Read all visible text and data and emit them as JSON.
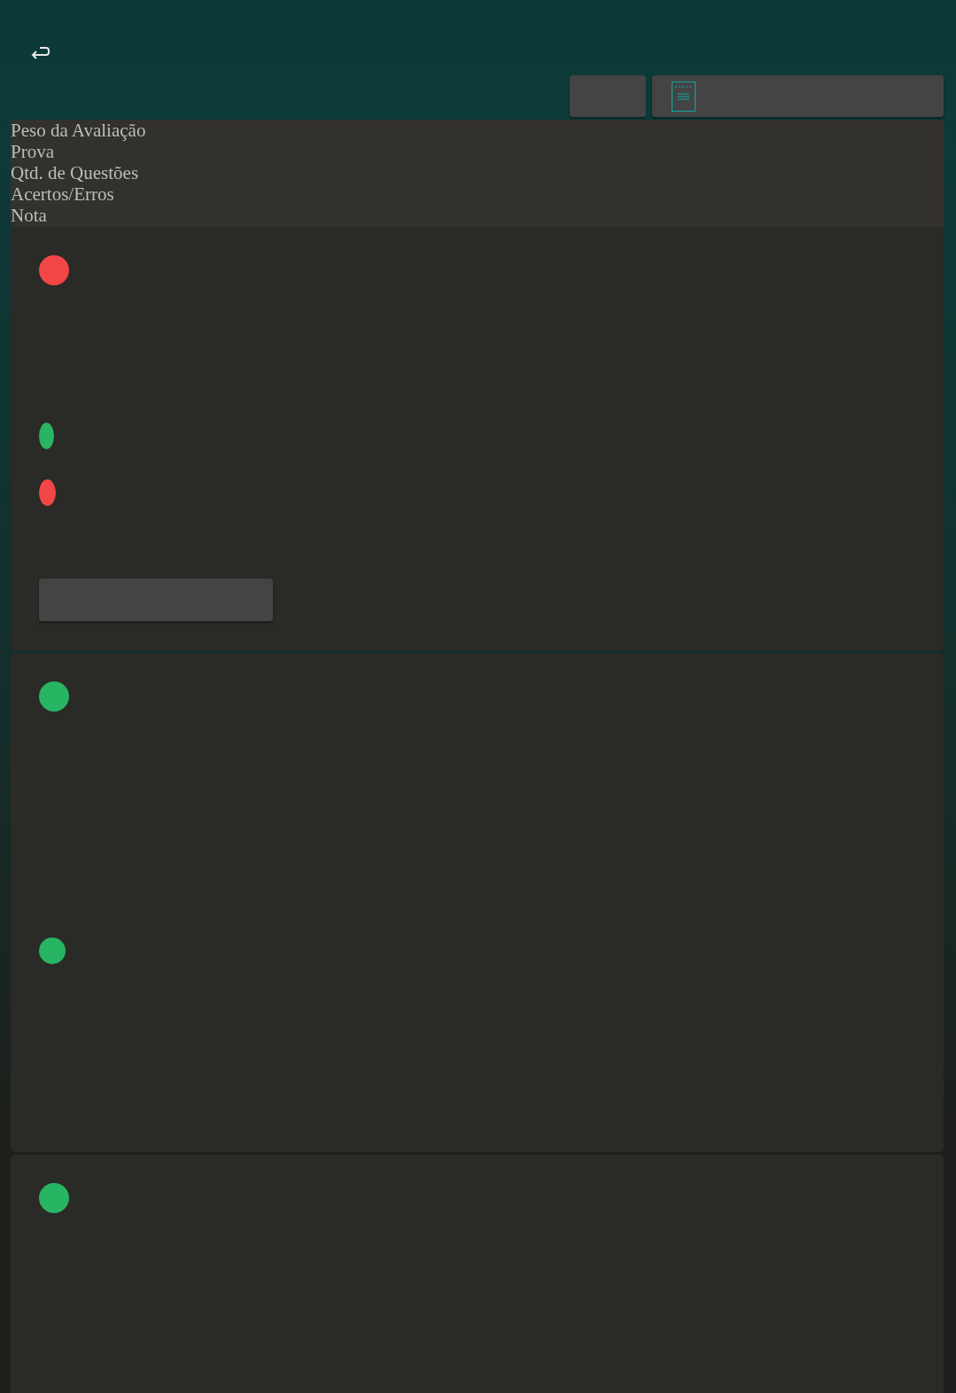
{
  "columns": [
    "Peso da Avaliação",
    "Prova",
    "Qtd. de Questões",
    "Acertos/Erros",
    "Nota"
  ],
  "cards": [
    {
      "dots": [
        {
          "kind": "round",
          "color": "#f24646"
        },
        {
          "kind": "oval",
          "color": "#27b463"
        },
        {
          "kind": "oval",
          "color": "#f24646"
        }
      ],
      "button": true
    },
    {
      "dots": [
        {
          "kind": "round",
          "color": "#27b463"
        },
        {
          "kind": "round",
          "color": "#27b463"
        }
      ],
      "button": false
    },
    {
      "dots": [
        {
          "kind": "round",
          "color": "#27b463"
        }
      ],
      "button": false
    }
  ]
}
